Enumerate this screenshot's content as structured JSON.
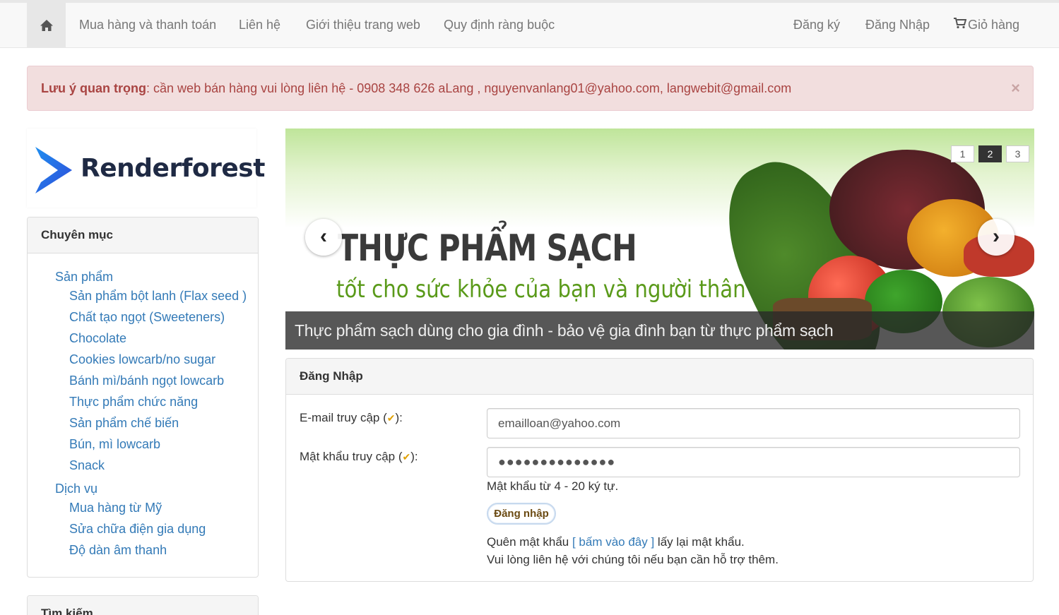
{
  "nav": {
    "home_icon": "home-icon",
    "left": [
      "Mua hàng và thanh toán",
      "Liên hệ",
      "Giới thiệu trang web",
      "Quy định ràng buộc"
    ],
    "right": [
      "Đăng ký",
      "Đăng Nhập"
    ],
    "cart_label": "Giỏ hàng",
    "cart_icon": "cart-icon"
  },
  "alert": {
    "title": "Lưu ý quan trọng",
    "message": ": cần web bán hàng vui lòng liên hệ - 0908 348 626 aLang , nguyenvanlang01@yahoo.com, langwebit@gmail.com",
    "close": "×"
  },
  "logo": {
    "text": "Renderforest"
  },
  "categories": {
    "title": "Chuyên mục",
    "groups": [
      {
        "label": "Sản phẩm",
        "items": [
          "Sản phẩm bột lanh (Flax seed )",
          "Chất tạo ngọt (Sweeteners)",
          "Chocolate",
          "Cookies lowcarb/no sugar",
          "Bánh mì/bánh ngọt lowcarb",
          "Thực phẩm chức năng",
          "Sản phẩm chế biến",
          "Bún, mì lowcarb",
          "Snack"
        ]
      },
      {
        "label": "Dịch vụ",
        "items": [
          "Mua hàng từ Mỹ",
          "Sửa chữa điện gia dụng",
          "Độ dàn âm thanh"
        ]
      }
    ]
  },
  "search_panel": {
    "title": "Tìm kiếm"
  },
  "banner": {
    "headline": "THỰC PHẨM SẠCH",
    "subline": "tốt cho sức khỏe của bạn và người thân",
    "caption": "Thực phẩm sạch dùng cho gia đình - bảo vệ gia đình bạn từ thực phẩm sạch",
    "pages": [
      "1",
      "2",
      "3"
    ],
    "active_page": "2",
    "prev": "‹",
    "next": "›"
  },
  "login": {
    "title": "Đăng Nhập",
    "email_label_pre": "E-mail truy cập (",
    "email_label_post": "):",
    "password_label_pre": "Mật khẩu truy cập (",
    "password_label_post": "):",
    "check_mark": "✔",
    "email_value": "emailloan@yahoo.com",
    "password_value": "●●●●●●●●●●●●●●",
    "password_hint": "Mật khẩu từ 4 - 20 ký tự.",
    "submit": "Đăng nhập",
    "forgot_pre": "Quên mật khẩu ",
    "forgot_link": "[ bấm vào đây ]",
    "forgot_post": " lấy lại mật khẩu.",
    "support": "Vui lòng liên hệ với chúng tôi nếu bạn cần hỗ trợ thêm."
  },
  "colors": {
    "link": "#337ab7",
    "alert_text": "#a94442",
    "alert_bg": "#f2dede"
  }
}
